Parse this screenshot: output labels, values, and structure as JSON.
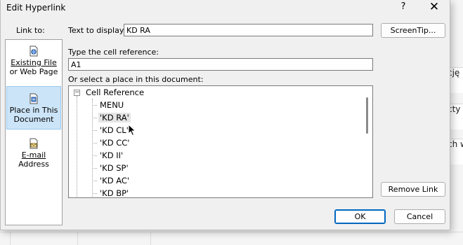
{
  "background": {
    "cells": [
      "cję",
      "cty n",
      "ch w"
    ]
  },
  "dialog": {
    "title": "Edit Hyperlink",
    "help_icon": "?",
    "close_icon": "✕"
  },
  "link_to": {
    "label": "Link to:",
    "items": [
      {
        "line1": "Existing File",
        "line2": "or Web Page",
        "icon": "existing-file-icon"
      },
      {
        "line1": "Place in This",
        "line2": "Document",
        "icon": "place-in-document-icon"
      },
      {
        "line1": "E-mail",
        "line2": "Address",
        "icon": "email-icon"
      }
    ]
  },
  "text_to_display": {
    "label": "Text to display:",
    "value": "KD RA"
  },
  "screentip_button": "ScreenTip...",
  "cell_reference": {
    "label": "Type the cell reference:",
    "value": "A1"
  },
  "place_label": "Or select a place in this document:",
  "tree": {
    "root": "Cell Reference",
    "toggle": "−",
    "items": [
      "MENU",
      "'KD RA'",
      "'KD CL'",
      "'KD CC'",
      "'KD II'",
      "'KD SP'",
      "'KD AC'",
      "'KD BP'"
    ]
  },
  "remove_link_button": "Remove Link",
  "ok_button": "OK",
  "cancel_button": "Cancel"
}
